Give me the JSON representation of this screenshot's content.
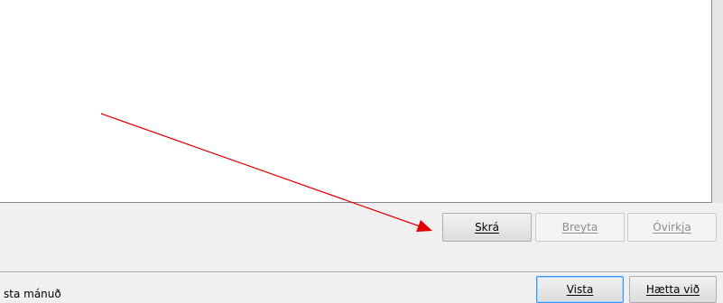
{
  "list_buttons": {
    "skra": "Skrá",
    "breyta": "Breyta",
    "ovirkja": "Óvirkja"
  },
  "dialog_buttons": {
    "vista": "Vista",
    "haetta": "Hætta við"
  },
  "status": {
    "partial_text": "sta mánuð"
  },
  "annotation": {
    "arrow_color": "#e00000"
  }
}
